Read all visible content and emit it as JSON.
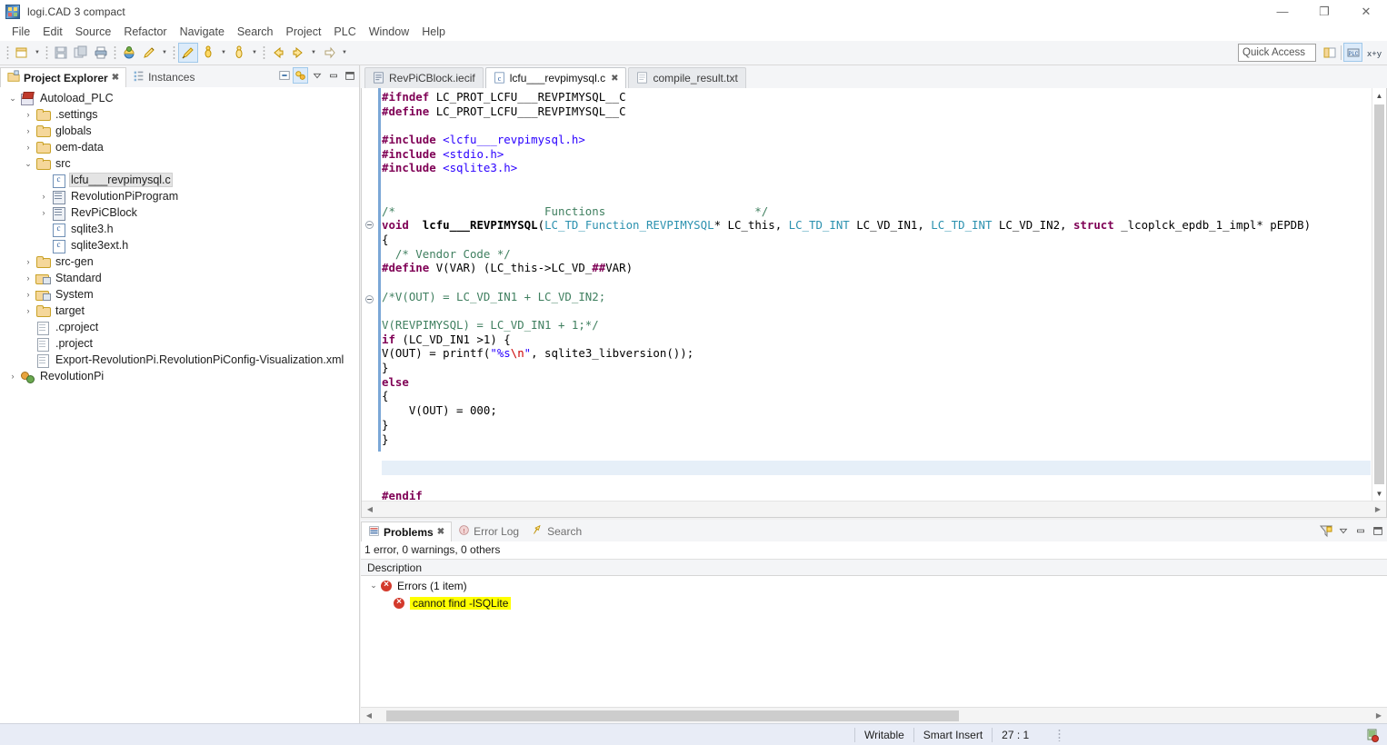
{
  "window": {
    "title": "logi.CAD 3 compact",
    "icon": "app-icon",
    "minimize": "—",
    "maximize": "❐",
    "close": "✕"
  },
  "menubar": {
    "items": [
      {
        "label": "File"
      },
      {
        "label": "Edit"
      },
      {
        "label": "Source"
      },
      {
        "label": "Refactor"
      },
      {
        "label": "Navigate"
      },
      {
        "label": "Search"
      },
      {
        "label": "Project"
      },
      {
        "label": "PLC"
      },
      {
        "label": "Window"
      },
      {
        "label": "Help"
      }
    ]
  },
  "toolbar": {
    "buttons": [
      {
        "name": "new-wizard-icon"
      },
      {
        "name": "save-icon"
      },
      {
        "name": "save-all-icon"
      },
      {
        "name": "print-icon"
      },
      {
        "name": "build-icon"
      },
      {
        "name": "run-external-tools-icon"
      },
      {
        "name": "run-icon"
      },
      {
        "name": "debug-icon"
      },
      {
        "name": "open-type-icon"
      },
      {
        "name": "back-icon"
      },
      {
        "name": "forward-icon"
      },
      {
        "name": "next-annotation-icon"
      }
    ],
    "quick_access": {
      "value": "",
      "placeholder": "Quick Access"
    },
    "perspectives": [
      {
        "name": "open-perspective-icon"
      },
      {
        "name": "plc-perspective-icon"
      },
      {
        "name": "variables-perspective-icon"
      }
    ]
  },
  "project_explorer": {
    "tabs": [
      {
        "label": "Project Explorer",
        "active": true,
        "icon": "project-explorer-icon",
        "closable": true
      },
      {
        "label": "Instances",
        "active": false,
        "icon": "instances-icon",
        "closable": false
      }
    ],
    "tools": [
      {
        "name": "collapse-all-icon"
      },
      {
        "name": "link-with-editor-icon"
      },
      {
        "name": "view-menu-icon"
      },
      {
        "name": "minimize-view-icon"
      },
      {
        "name": "maximize-view-icon"
      }
    ],
    "tree": [
      {
        "label": "Autoload_PLC",
        "depth": 0,
        "twisty": "expanded",
        "icon": "plc-project-icon",
        "selected": false
      },
      {
        "label": ".settings",
        "depth": 1,
        "twisty": "collapsed",
        "icon": "folder-icon",
        "selected": false
      },
      {
        "label": "globals",
        "depth": 1,
        "twisty": "collapsed",
        "icon": "folder-icon",
        "selected": false
      },
      {
        "label": "oem-data",
        "depth": 1,
        "twisty": "collapsed",
        "icon": "folder-icon",
        "selected": false
      },
      {
        "label": "src",
        "depth": 1,
        "twisty": "expanded",
        "icon": "folder-icon",
        "selected": false
      },
      {
        "label": "lcfu___revpimysql.c",
        "depth": 2,
        "twisty": "none",
        "icon": "c-file-icon",
        "selected": true
      },
      {
        "label": "RevolutionPiProgram",
        "depth": 2,
        "twisty": "collapsed",
        "icon": "pou-icon",
        "selected": false
      },
      {
        "label": "RevPiCBlock",
        "depth": 2,
        "twisty": "collapsed",
        "icon": "pou-icon",
        "selected": false
      },
      {
        "label": "sqlite3.h",
        "depth": 2,
        "twisty": "none",
        "icon": "c-file-icon",
        "selected": false
      },
      {
        "label": "sqlite3ext.h",
        "depth": 2,
        "twisty": "none",
        "icon": "c-file-icon",
        "selected": false
      },
      {
        "label": "src-gen",
        "depth": 1,
        "twisty": "collapsed",
        "icon": "folder-icon",
        "selected": false
      },
      {
        "label": "Standard",
        "depth": 1,
        "twisty": "collapsed",
        "icon": "library-folder-icon",
        "selected": false
      },
      {
        "label": "System",
        "depth": 1,
        "twisty": "collapsed",
        "icon": "library-folder-icon",
        "selected": false
      },
      {
        "label": "target",
        "depth": 1,
        "twisty": "collapsed",
        "icon": "folder-icon",
        "selected": false
      },
      {
        "label": ".cproject",
        "depth": 1,
        "twisty": "none",
        "icon": "xml-file-icon",
        "selected": false
      },
      {
        "label": ".project",
        "depth": 1,
        "twisty": "none",
        "icon": "xml-file-icon",
        "selected": false
      },
      {
        "label": "Export-RevolutionPi.RevolutionPiConfig-Visualization.xml",
        "depth": 1,
        "twisty": "none",
        "icon": "xml-file-icon",
        "selected": false
      },
      {
        "label": "RevolutionPi",
        "depth": 0,
        "twisty": "collapsed",
        "icon": "device-icon",
        "selected": false
      }
    ]
  },
  "editor": {
    "tabs": [
      {
        "label": "RevPiCBlock.iecif",
        "active": false,
        "icon": "iecif-file-icon",
        "closable": false
      },
      {
        "label": "lcfu___revpimysql.c",
        "active": true,
        "icon": "c-file-icon",
        "closable": true
      },
      {
        "label": "compile_result.txt",
        "active": false,
        "icon": "text-file-icon",
        "closable": false
      }
    ],
    "lines": [
      [
        {
          "t": "#ifndef ",
          "c": "k-pre"
        },
        {
          "t": "LC_PROT_LCFU___REVPIMYSQL__C",
          "c": "k-plain"
        }
      ],
      [
        {
          "t": "#define ",
          "c": "k-pre"
        },
        {
          "t": "LC_PROT_LCFU___REVPIMYSQL__C",
          "c": "k-plain"
        }
      ],
      [],
      [
        {
          "t": "#include ",
          "c": "k-pre"
        },
        {
          "t": "<lcfu___revpimysql.h>",
          "c": "k-hdr"
        }
      ],
      [
        {
          "t": "#include ",
          "c": "k-pre"
        },
        {
          "t": "<stdio.h>",
          "c": "k-hdr"
        }
      ],
      [
        {
          "t": "#include ",
          "c": "k-pre"
        },
        {
          "t": "<sqlite3.h>",
          "c": "k-hdr"
        }
      ],
      [],
      [],
      [
        {
          "t": "/*                      Functions                      */",
          "c": "k-cm"
        }
      ],
      [
        {
          "t": "void ",
          "c": "k-kw"
        },
        {
          "t": " lcfu___REVPIMYSQL",
          "c": "k-fn"
        },
        {
          "t": "(",
          "c": "k-plain"
        },
        {
          "t": "LC_TD_Function_REVPIMYSQL",
          "c": "k-typ"
        },
        {
          "t": "* LC_this, ",
          "c": "k-plain"
        },
        {
          "t": "LC_TD_INT",
          "c": "k-typ"
        },
        {
          "t": " LC_VD_IN1, ",
          "c": "k-plain"
        },
        {
          "t": "LC_TD_INT",
          "c": "k-typ"
        },
        {
          "t": " LC_VD_IN2, ",
          "c": "k-plain"
        },
        {
          "t": "struct ",
          "c": "k-kw"
        },
        {
          "t": "_lcoplck_epdb_1_impl* pEPDB)",
          "c": "k-plain"
        }
      ],
      [
        {
          "t": "{",
          "c": "k-plain"
        }
      ],
      [
        {
          "t": "  /* Vendor Code */",
          "c": "k-cm"
        }
      ],
      [
        {
          "t": "#define ",
          "c": "k-pre"
        },
        {
          "t": "V(VAR) (LC_this->LC_VD_",
          "c": "k-plain"
        },
        {
          "t": "##",
          "c": "k-pre"
        },
        {
          "t": "VAR)",
          "c": "k-plain"
        }
      ],
      [],
      [
        {
          "t": "/*V(OUT) = LC_VD_IN1 + LC_VD_IN2;",
          "c": "k-cm"
        }
      ],
      [],
      [
        {
          "t": "V(REVPIMYSQL) = LC_VD_IN1 + 1;*/",
          "c": "k-cm"
        }
      ],
      [
        {
          "t": "if ",
          "c": "k-kw"
        },
        {
          "t": "(LC_VD_IN1 >1) {",
          "c": "k-plain"
        }
      ],
      [
        {
          "t": "V(OUT) = printf(",
          "c": "k-plain"
        },
        {
          "t": "\"%s",
          "c": "k-str"
        },
        {
          "t": "\\n",
          "c": "k-esc"
        },
        {
          "t": "\"",
          "c": "k-str"
        },
        {
          "t": ", sqlite3_libversion());",
          "c": "k-plain"
        }
      ],
      [
        {
          "t": "}",
          "c": "k-plain"
        }
      ],
      [
        {
          "t": "else",
          "c": "k-kw"
        }
      ],
      [
        {
          "t": "{",
          "c": "k-plain"
        }
      ],
      [
        {
          "t": "    V(OUT) = 000;",
          "c": "k-plain"
        }
      ],
      [
        {
          "t": "}",
          "c": "k-plain"
        }
      ],
      [
        {
          "t": "}",
          "c": "k-plain"
        }
      ],
      [],
      [],
      [
        {
          "t": "",
          "c": "k-plain",
          "current": true
        }
      ],
      [
        {
          "t": "#endif",
          "c": "k-pre"
        }
      ]
    ],
    "current_line_index": 26
  },
  "problems": {
    "tabs": [
      {
        "label": "Problems",
        "active": true,
        "icon": "problems-icon",
        "closable": true
      },
      {
        "label": "Error Log",
        "active": false,
        "icon": "error-log-icon",
        "closable": false
      },
      {
        "label": "Search",
        "active": false,
        "icon": "search-icon",
        "closable": false
      }
    ],
    "tools": [
      {
        "name": "filters-icon"
      },
      {
        "name": "view-menu-icon"
      },
      {
        "name": "minimize-view-icon"
      },
      {
        "name": "maximize-view-icon"
      }
    ],
    "summary": "1 error, 0 warnings, 0 others",
    "column_header": "Description",
    "group": {
      "label": "Errors (1 item)",
      "expanded": true
    },
    "items": [
      {
        "label": "cannot find -lSQLite",
        "highlighted": true
      }
    ]
  },
  "statusbar": {
    "writable": "Writable",
    "insert_mode": "Smart Insert",
    "position": "27 : 1"
  },
  "colors": {
    "accent": "#dcebfa",
    "error": "#d33a2c",
    "highlight": "#ffff00",
    "current_line": "#e6eff8",
    "status_bg": "#e8ecf6"
  }
}
